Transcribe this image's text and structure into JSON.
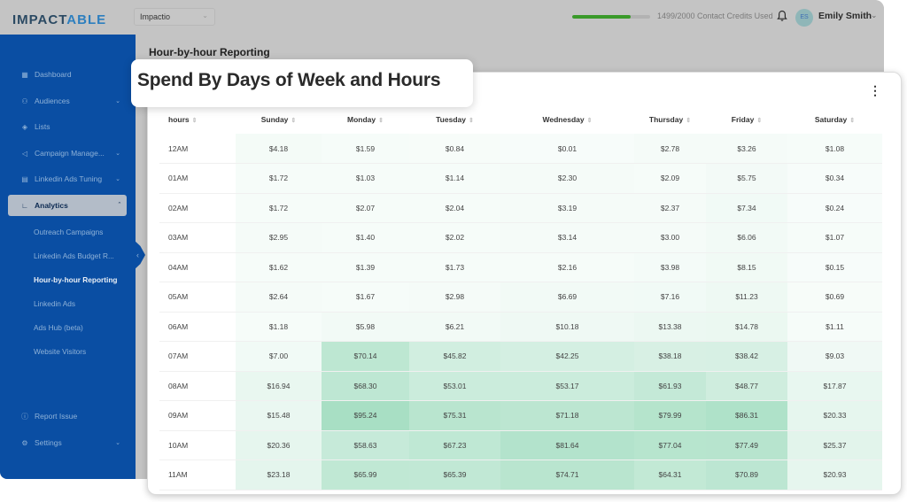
{
  "app": {
    "logo": {
      "part1": "IMPACT",
      "part2": "ABLE"
    },
    "workspace": "Impactio"
  },
  "header": {
    "credits_used": 1499,
    "credits_total": 2000,
    "credits_label": "1499/2000 Contact Credits Used",
    "user_initials": "ES",
    "user_name": "Emily Smith",
    "icons": {
      "notifications": "bell-icon",
      "user_menu": "chevron-down-icon"
    }
  },
  "sidebar": {
    "items": [
      {
        "label": "Dashboard",
        "icon": "grid-icon",
        "expandable": false
      },
      {
        "label": "Audiences",
        "icon": "users-icon",
        "expandable": true
      },
      {
        "label": "Lists",
        "icon": "target-icon",
        "expandable": false
      },
      {
        "label": "Campaign Manage...",
        "icon": "megaphone-icon",
        "expandable": true
      },
      {
        "label": "Linkedin Ads Tuning",
        "icon": "calendar-icon",
        "expandable": true
      },
      {
        "label": "Analytics",
        "icon": "chart-icon",
        "expandable": true,
        "active": true
      }
    ],
    "analytics_sub": [
      {
        "label": "Outreach Campaigns"
      },
      {
        "label": "Linkedin Ads Budget R..."
      },
      {
        "label": "Hour-by-hour Reporting",
        "current": true
      },
      {
        "label": "Linkedin Ads"
      },
      {
        "label": "Ads Hub (beta)"
      },
      {
        "label": "Website Visitors"
      }
    ],
    "bottom": [
      {
        "label": "Report Issue",
        "icon": "alert-circle-icon"
      },
      {
        "label": "Settings",
        "icon": "gear-icon",
        "expandable": true
      }
    ]
  },
  "page": {
    "heading": "Hour-by-hour Reporting",
    "card_title": "Spend By Days of Week and Hours"
  },
  "heatmap": {
    "accent_color": "#7fd0a8",
    "max_value": 95.24,
    "columns": [
      "hours",
      "Sunday",
      "Monday",
      "Tuesday",
      "Wednesday",
      "Thursday",
      "Friday",
      "Saturday"
    ],
    "rows": [
      {
        "hour": "12AM",
        "values": [
          "$4.18",
          "$1.59",
          "$0.84",
          "$0.01",
          "$2.78",
          "$3.26",
          "$1.08"
        ]
      },
      {
        "hour": "01AM",
        "values": [
          "$1.72",
          "$1.03",
          "$1.14",
          "$2.30",
          "$2.09",
          "$5.75",
          "$0.34"
        ]
      },
      {
        "hour": "02AM",
        "values": [
          "$1.72",
          "$2.07",
          "$2.04",
          "$3.19",
          "$2.37",
          "$7.34",
          "$0.24"
        ]
      },
      {
        "hour": "03AM",
        "values": [
          "$2.95",
          "$1.40",
          "$2.02",
          "$3.14",
          "$3.00",
          "$6.06",
          "$1.07"
        ]
      },
      {
        "hour": "04AM",
        "values": [
          "$1.62",
          "$1.39",
          "$1.73",
          "$2.16",
          "$3.98",
          "$8.15",
          "$0.15"
        ]
      },
      {
        "hour": "05AM",
        "values": [
          "$2.64",
          "$1.67",
          "$2.98",
          "$6.69",
          "$7.16",
          "$11.23",
          "$0.69"
        ]
      },
      {
        "hour": "06AM",
        "values": [
          "$1.18",
          "$5.98",
          "$6.21",
          "$10.18",
          "$13.38",
          "$14.78",
          "$1.11"
        ]
      },
      {
        "hour": "07AM",
        "values": [
          "$7.00",
          "$70.14",
          "$45.82",
          "$42.25",
          "$38.18",
          "$38.42",
          "$9.03"
        ]
      },
      {
        "hour": "08AM",
        "values": [
          "$16.94",
          "$68.30",
          "$53.01",
          "$53.17",
          "$61.93",
          "$48.77",
          "$17.87"
        ]
      },
      {
        "hour": "09AM",
        "values": [
          "$15.48",
          "$95.24",
          "$75.31",
          "$71.18",
          "$79.99",
          "$86.31",
          "$20.33"
        ]
      },
      {
        "hour": "10AM",
        "values": [
          "$20.36",
          "$58.63",
          "$67.23",
          "$81.64",
          "$77.04",
          "$77.49",
          "$25.37"
        ]
      },
      {
        "hour": "11AM",
        "values": [
          "$23.18",
          "$65.99",
          "$65.39",
          "$74.71",
          "$64.31",
          "$70.89",
          "$20.93"
        ]
      }
    ]
  }
}
